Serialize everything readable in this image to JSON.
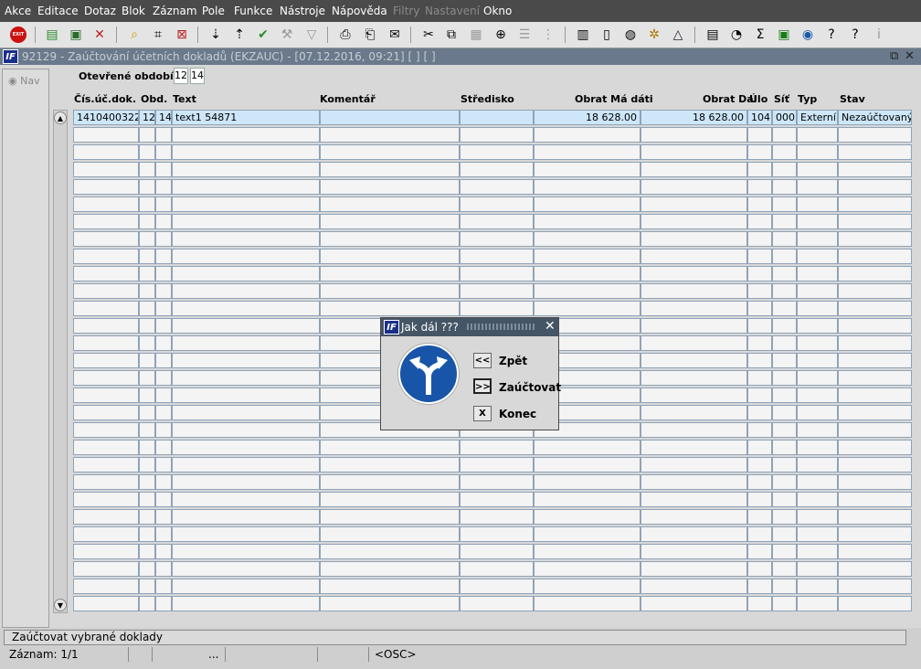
{
  "menu": {
    "items": [
      "Akce",
      "Editace",
      "Dotaz",
      "Blok",
      "Záznam",
      "Pole",
      "Funkce",
      "Nástroje",
      "Nápověda",
      "Filtry",
      "Nastavení",
      "Okno"
    ]
  },
  "toolbar": {
    "exit_label": "EXIT"
  },
  "window": {
    "title": "92129 - Zaúčtování účetních dokladů (EKZAUC) - [07.12.2016, 09:21]  [ ]  [ ]",
    "logo": "IF"
  },
  "nav": {
    "label": "Nav"
  },
  "period": {
    "label": "Otevřené období",
    "values": [
      "12",
      "14"
    ]
  },
  "table": {
    "headers": [
      "Čís.úč.dok.",
      "Obd.",
      "Text",
      "Komentář",
      "Středisko",
      "Obrat Má dáti",
      "Obrat Dal",
      "Úlo",
      "Síť",
      "Typ",
      "Stav"
    ],
    "rows": [
      [
        "1410400322",
        "12",
        "14",
        "text1 54871",
        "",
        "",
        "18 628.00",
        "18 628.00",
        "104",
        "000",
        "Externí",
        "Nezaúčtovaný"
      ]
    ]
  },
  "dialog": {
    "title": "Jak dál ???",
    "back_btn": "<<",
    "back_label": "Zpět",
    "post_btn": ">>",
    "post_label": "Zaúčtovat",
    "end_btn": "X",
    "end_label": "Konec"
  },
  "status": {
    "message": "Zaúčtovat vybrané doklady",
    "record": "Záznam: 1/1",
    "ellipsis": "...",
    "mode": "<OSC>"
  }
}
